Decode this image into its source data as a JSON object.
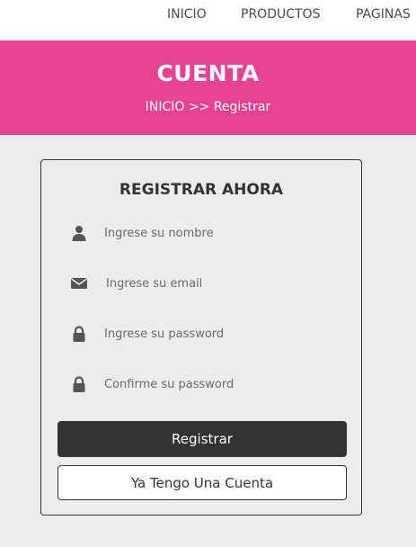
{
  "nav": {
    "items": [
      "INICIO",
      "PRODUCTOS",
      "PAGINAS"
    ]
  },
  "banner": {
    "title": "CUENTA",
    "breadcrumb": "INICIO >> Registrar"
  },
  "form": {
    "title": "REGISTRAR AHORA",
    "fields": [
      {
        "placeholder": "Ingrese su nombre",
        "icon": "user-icon"
      },
      {
        "placeholder": "Ingrese su email",
        "icon": "envelope-icon"
      },
      {
        "placeholder": "Ingrese su password",
        "icon": "lock-icon"
      },
      {
        "placeholder": "Confirme su password",
        "icon": "lock-icon"
      }
    ],
    "submit_label": "Registrar",
    "login_label": "Ya Tengo Una Cuenta"
  },
  "colors": {
    "accent": "#e84393",
    "dark": "#333333",
    "background": "#ececec"
  }
}
